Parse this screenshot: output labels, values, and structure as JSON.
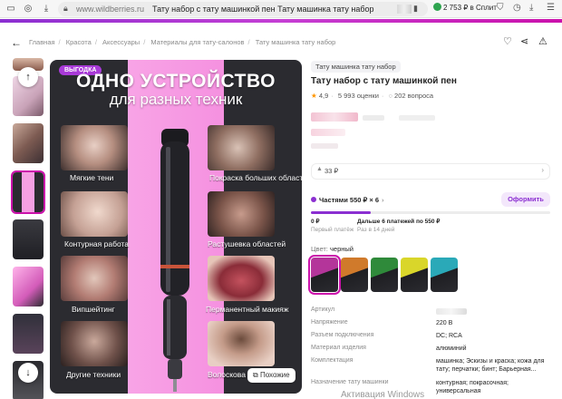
{
  "browser": {
    "url": "www.wildberries.ru",
    "tab_title": "Тату набор с тату машинкой пен Тату машинка тату набор",
    "split_text": "2 753 ₽ в Сплит"
  },
  "breadcrumb": [
    "Главная",
    "Красота",
    "Аксессуары",
    "Материалы для тату-салонов",
    "Тату машинка тату набор"
  ],
  "gallery": {
    "promo_badge": "ВЫГОДКА",
    "headline_1": "ОДНО УСТРОЙСТВО",
    "headline_2": "для разных техник",
    "tiles": [
      "Мягкие тени",
      "Покраска больших областей",
      "Контурная работа",
      "Растушевка областей",
      "Випшейтинг",
      "Перманентный макияж",
      "Другие техники",
      "Волоскова"
    ],
    "similar_label": "Похожие"
  },
  "product": {
    "brand_pill": "Тату машинка тату набор",
    "title": "Тату набор с тату машинкой пен",
    "rating": "4,9",
    "reviews": "5 993 оценки",
    "questions": "202 вопроса"
  },
  "coupon": {
    "text": "33 ₽"
  },
  "installments": {
    "label": "Частями 550 ₽ × 6",
    "order_button": "Оформить",
    "paid_fraction": 0.25,
    "now_value": "0 ₽",
    "now_sub": "Первый платёж",
    "later_value": "Дальше 6 платежей по 550 ₽",
    "later_sub": "Раз в 14 дней"
  },
  "colors": {
    "label": "Цвет:",
    "value": "черный",
    "swatches": [
      "#b4359a",
      "#d07a2b",
      "#2f8a3a",
      "#d9d62a",
      "#2aa9b8"
    ]
  },
  "specs": [
    {
      "key": "Артикул",
      "value": ""
    },
    {
      "key": "Напряжение",
      "value": "220 В"
    },
    {
      "key": "Разъем подключения",
      "value": "DC; RCA"
    },
    {
      "key": "Материал изделия",
      "value": "алюминий"
    },
    {
      "key": "Комплектация",
      "value": "машинка; Эскизы и краска; кожа для тату; перчатки; бинт; Барьерная..."
    },
    {
      "key": "Назначение тату машинки",
      "value": "контурная; покрасочная; универсальная"
    }
  ],
  "os_watermark": "Активация Windows"
}
